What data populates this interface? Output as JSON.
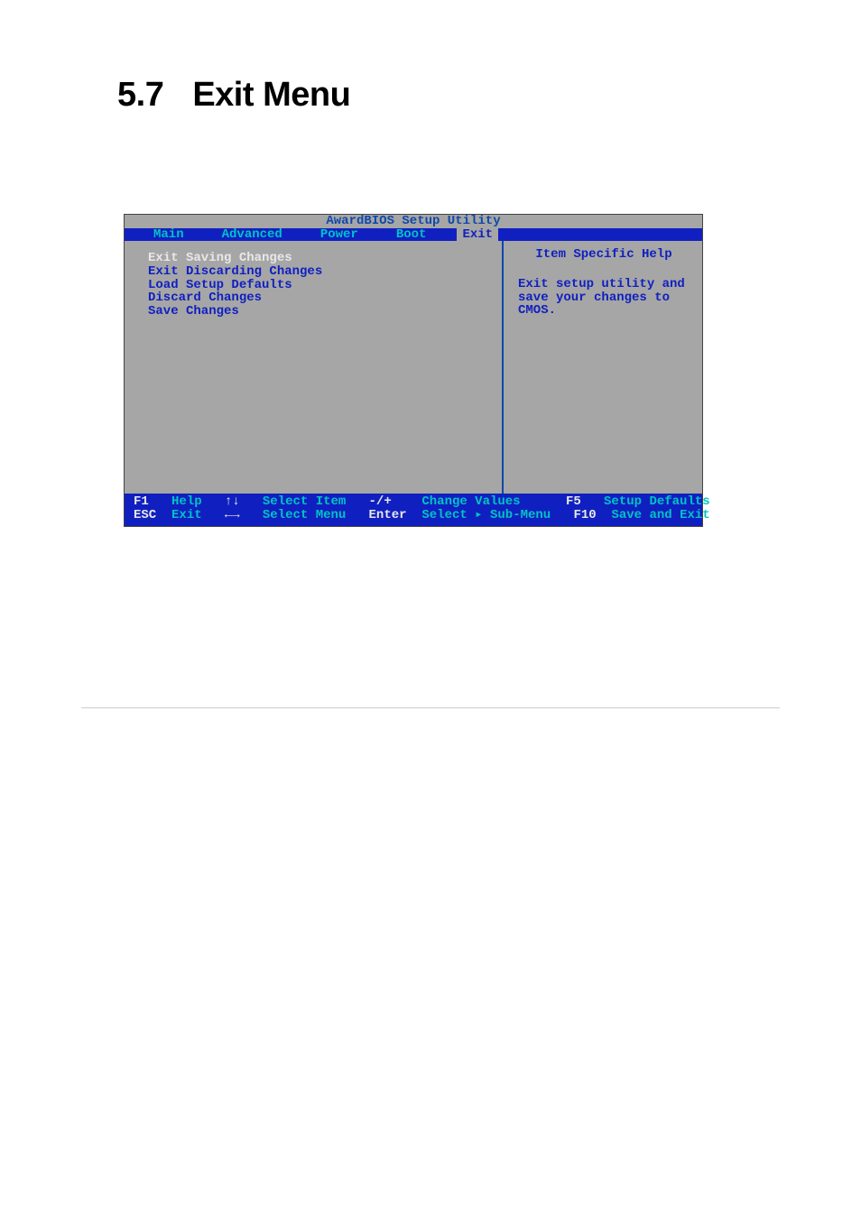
{
  "heading": {
    "number": "5.7",
    "title": "Exit Menu"
  },
  "bios": {
    "title": "AwardBIOS Setup Utility",
    "tabs": [
      "Main",
      "Advanced",
      "Power",
      "Boot",
      "Exit"
    ],
    "active_tab_index": 4,
    "menu_items": [
      "Exit Saving Changes",
      "Exit Discarding Changes",
      "Load Setup Defaults",
      "Discard Changes",
      "Save Changes"
    ],
    "selected_item_index": 0,
    "help": {
      "title": "Item Specific Help",
      "body": "Exit setup utility and save your changes to CMOS."
    },
    "footer": {
      "row1": {
        "k1": "F1",
        "v1": "Help",
        "k2": "↑↓",
        "v2": "Select Item",
        "k3": "-/+",
        "v3": "Change Values",
        "k4": "F5",
        "v4": "Setup Defaults"
      },
      "row2": {
        "k1": "ESC",
        "v1": "Exit",
        "k2": "←→",
        "v2": "Select Menu",
        "k3": "Enter",
        "v3": "Select ▸ Sub-Menu",
        "k4": "F10",
        "v4": "Save and Exit"
      }
    }
  }
}
